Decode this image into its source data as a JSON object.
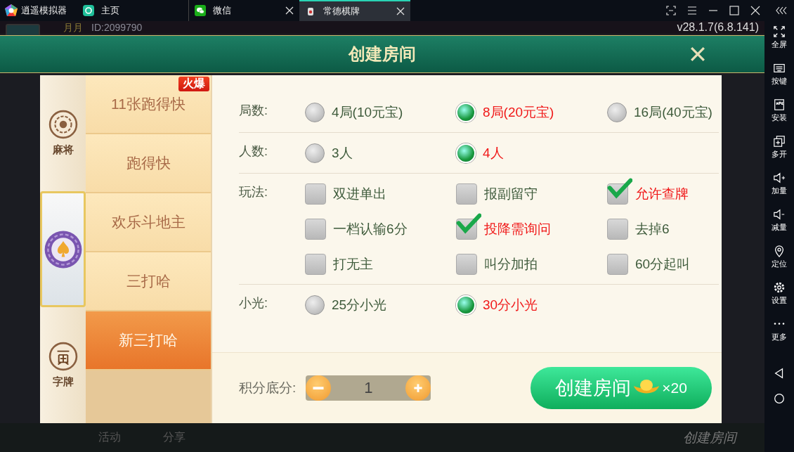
{
  "emulator": {
    "brand": "逍遥模拟器",
    "tabs": [
      {
        "label": "主页",
        "selected": false,
        "closable": false,
        "kind": "home"
      },
      {
        "label": "微信",
        "selected": false,
        "closable": true,
        "kind": "chat"
      },
      {
        "label": "常德棋牌",
        "selected": true,
        "closable": true,
        "kind": "game"
      }
    ],
    "tools": [
      {
        "label": "全屏",
        "kind": "fullscreen"
      },
      {
        "label": "按键",
        "kind": "keyboard"
      },
      {
        "label": "安装",
        "kind": "apk"
      },
      {
        "label": "多开",
        "kind": "multi"
      },
      {
        "label": "加量",
        "kind": "volup"
      },
      {
        "label": "减量",
        "kind": "voldown"
      },
      {
        "label": "定位",
        "kind": "location"
      },
      {
        "label": "设置",
        "kind": "settings"
      },
      {
        "label": "更多",
        "kind": "more"
      }
    ]
  },
  "game": {
    "user_name": "月月",
    "user_id": "ID:2099790",
    "version": "v28.1.7(6.8.141)",
    "bottom_nav": [
      "活动",
      "分享"
    ],
    "bottom_button": "创建房间"
  },
  "dialog": {
    "title": "创建房间",
    "categories": [
      {
        "label": "麻将",
        "selected": false,
        "kind": "mahjong"
      },
      {
        "selected": true,
        "kind": "poker"
      },
      {
        "label": "字牌",
        "selected": false,
        "kind": "zipai"
      }
    ],
    "games": [
      {
        "label": "11张跑得快",
        "selected": false,
        "badge": "火爆"
      },
      {
        "label": "跑得快",
        "selected": false
      },
      {
        "label": "欢乐斗地主",
        "selected": false
      },
      {
        "label": "三打哈",
        "selected": false
      },
      {
        "label": "新三打哈",
        "selected": true
      }
    ],
    "rows": [
      {
        "label": "局数:",
        "kind": "radio",
        "options": [
          {
            "label": "4局(10元宝)",
            "selected": false
          },
          {
            "label": "8局(20元宝)",
            "selected": true
          },
          {
            "label": "16局(40元宝)",
            "selected": false
          }
        ]
      },
      {
        "label": "人数:",
        "kind": "radio",
        "options": [
          {
            "label": "3人",
            "selected": false
          },
          {
            "label": "4人",
            "selected": true
          }
        ]
      },
      {
        "label": "玩法:",
        "kind": "checkbox",
        "options": [
          {
            "label": "双进单出",
            "checked": false
          },
          {
            "label": "报副留守",
            "checked": false
          },
          {
            "label": "允许查牌",
            "checked": true
          },
          {
            "label": "一档认输6分",
            "checked": false
          },
          {
            "label": "投降需询问",
            "checked": true
          },
          {
            "label": "去掉6",
            "checked": false
          },
          {
            "label": "打无主",
            "checked": false
          },
          {
            "label": "叫分加拍",
            "checked": false
          },
          {
            "label": "60分起叫",
            "checked": false
          }
        ]
      },
      {
        "label": "小光:",
        "kind": "radio",
        "options": [
          {
            "label": "25分小光",
            "selected": false
          },
          {
            "label": "30分小光",
            "selected": true
          }
        ]
      }
    ],
    "score": {
      "label": "积分底分:",
      "value": "1"
    },
    "create_button": {
      "label": "创建房间",
      "cost": "×20"
    }
  }
}
